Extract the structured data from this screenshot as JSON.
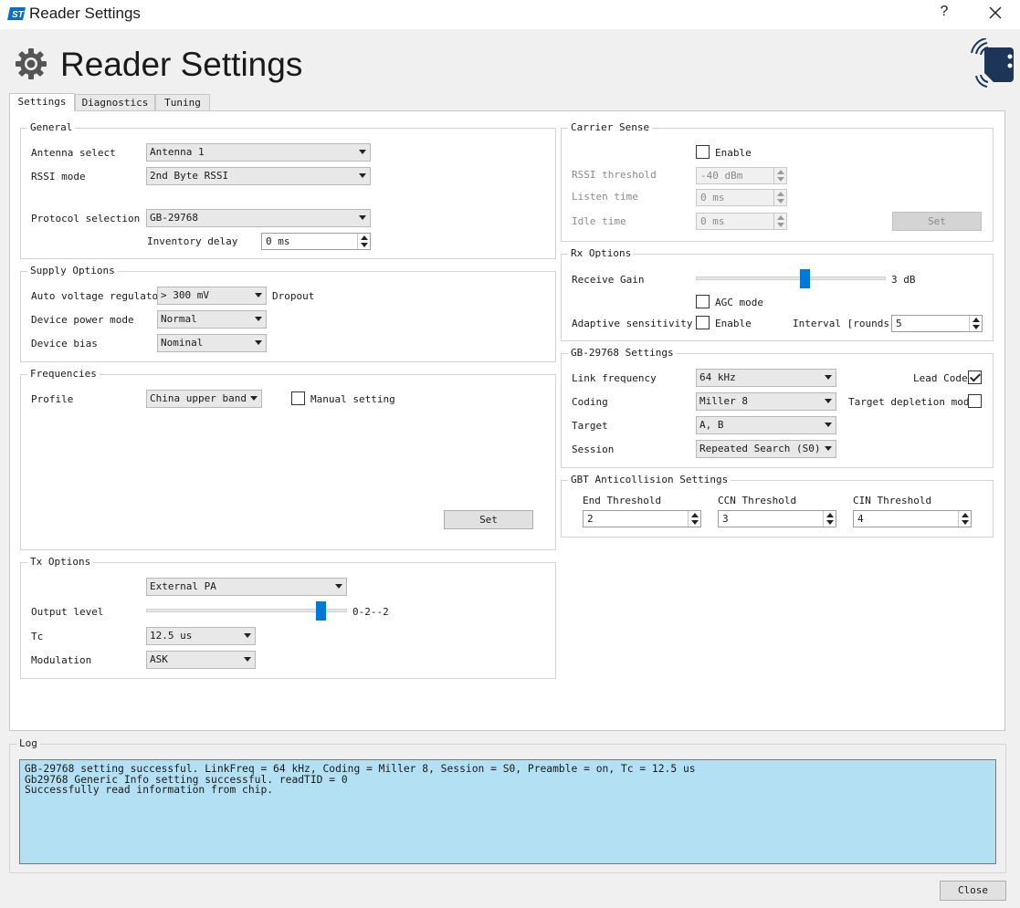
{
  "window": {
    "title": "Reader Settings",
    "help_label": "?",
    "brand_color": "#0078d7"
  },
  "header": {
    "title": "Reader Settings"
  },
  "tabs": [
    {
      "label": "Settings",
      "active": true
    },
    {
      "label": "Diagnostics",
      "active": false
    },
    {
      "label": "Tuning",
      "active": false
    }
  ],
  "general": {
    "title": "General",
    "antenna_label": "Antenna select",
    "antenna_value": "Antenna 1",
    "rssi_label": "RSSI mode",
    "rssi_value": "2nd Byte RSSI",
    "protocol_label": "Protocol selection",
    "protocol_value": "GB-29768",
    "inventory_delay_label": "Inventory delay",
    "inventory_delay_value": "0 ms"
  },
  "supply": {
    "title": "Supply Options",
    "avr_label": "Auto voltage regulator",
    "avr_value": "> 300 mV",
    "avr_suffix": "Dropout",
    "power_label": "Device power mode",
    "power_value": "Normal",
    "bias_label": "Device bias",
    "bias_value": "Nominal"
  },
  "frequencies": {
    "title": "Frequencies",
    "profile_label": "Profile",
    "profile_value": "China upper band",
    "manual_label": "Manual setting",
    "manual_checked": false,
    "set_label": "Set"
  },
  "tx": {
    "title": "Tx Options",
    "pa_value": "External PA",
    "output_label": "Output level",
    "output_slider_fraction": 0.87,
    "output_readout": "0-2--2",
    "tc_label": "Tc",
    "tc_value": "12.5 us",
    "modulation_label": "Modulation",
    "modulation_value": "ASK"
  },
  "carrier": {
    "title": "Carrier Sense",
    "enable_label": "Enable",
    "enable_checked": false,
    "rssi_label": "RSSI threshold",
    "rssi_value": "-40 dBm",
    "listen_label": "Listen time",
    "listen_value": "0 ms",
    "idle_label": "Idle time",
    "idle_value": "0 ms",
    "set_label": "Set"
  },
  "rx": {
    "title": "Rx Options",
    "gain_label": "Receive Gain",
    "gain_slider_fraction": 0.57,
    "gain_readout": "3 dB",
    "agc_label": "AGC mode",
    "agc_checked": false,
    "adaptive_label": "Adaptive sensitivity",
    "adaptive_enable_label": "Enable",
    "adaptive_checked": false,
    "interval_label": "Interval [rounds]",
    "interval_value": "5"
  },
  "gb": {
    "title": "GB-29768 Settings",
    "link_label": "Link frequency",
    "link_value": "64 kHz",
    "lead_label": "Lead Code",
    "lead_checked": true,
    "coding_label": "Coding",
    "coding_value": "Miller 8",
    "depletion_label": "Target depletion mode",
    "depletion_checked": false,
    "target_label": "Target",
    "target_value": "A, B",
    "session_label": "Session",
    "session_value": "Repeated Search (S0)"
  },
  "anticollision": {
    "title": "GBT Anticollision Settings",
    "end_label": "End Threshold",
    "end_value": "2",
    "ccn_label": "CCN Threshold",
    "ccn_value": "3",
    "cin_label": "CIN Threshold",
    "cin_value": "4"
  },
  "log": {
    "title": "Log",
    "background_color": "#b3e0f2",
    "lines": [
      "GB-29768 setting successful. LinkFreq = 64 kHz, Coding = Miller 8, Session = S0, Preamble = on, Tc = 12.5 us",
      "Gb29768 Generic Info setting successful. readTID = 0",
      "Successfully read information from chip."
    ]
  },
  "footer": {
    "close_label": "Close"
  }
}
